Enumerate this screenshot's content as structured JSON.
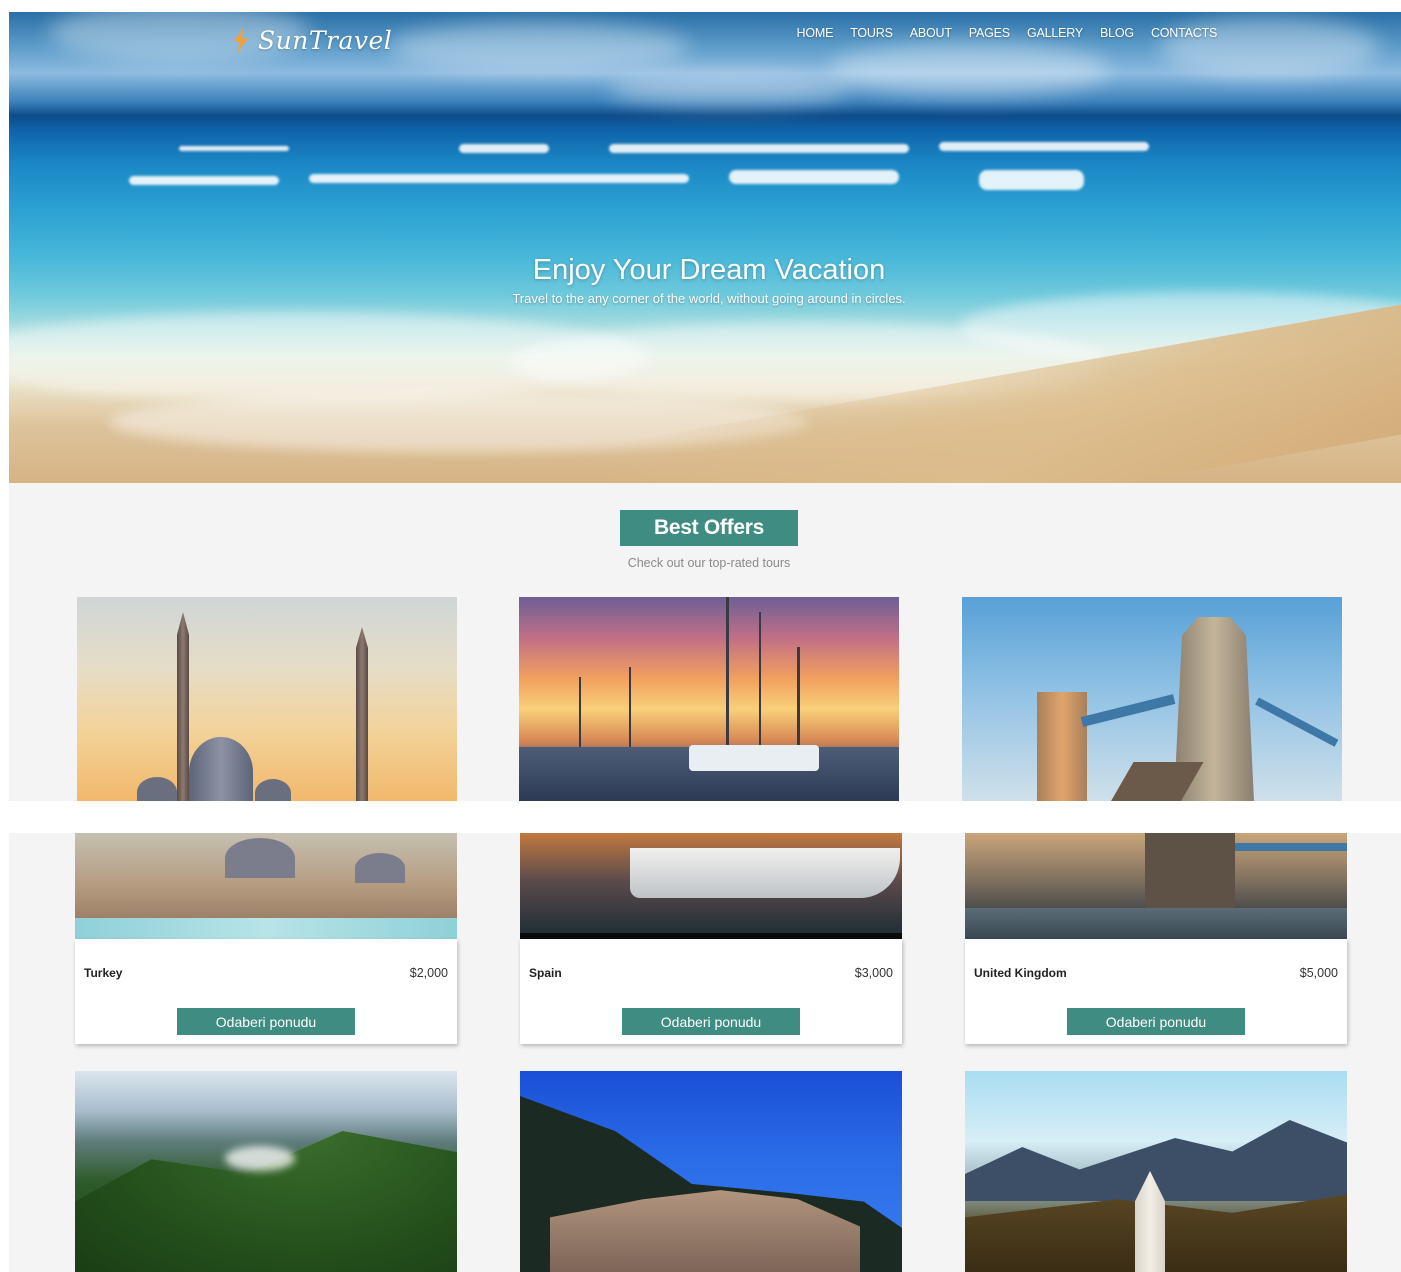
{
  "brand": {
    "name": "SunTravel",
    "accent": "#f2a03d"
  },
  "nav": [
    "HOME",
    "TOURS",
    "ABOUT",
    "PAGES",
    "GALLERY",
    "BLOG",
    "CONTACTS"
  ],
  "hero": {
    "title": "Enjoy Your Dream Vacation",
    "subtitle": "Travel to the any corner of the world, without going around in circles."
  },
  "offers": {
    "title": "Best Offers",
    "subtitle": "Check out our top-rated tours",
    "accent": "#3f8c82",
    "cards": [
      {
        "name": "Turkey",
        "price": "$2,000",
        "button": "Odaberi ponudu",
        "image": "istanbul-mosque-photo"
      },
      {
        "name": "Spain",
        "price": "$3,000",
        "button": "Odaberi ponudu",
        "image": "marina-sunset-photo"
      },
      {
        "name": "United Kingdom",
        "price": "$5,000",
        "button": "Odaberi ponudu",
        "image": "tower-bridge-photo"
      }
    ],
    "more_cards": [
      {
        "image": "green-mountains-photo"
      },
      {
        "image": "coastal-town-night-photo"
      },
      {
        "image": "alpine-church-photo"
      }
    ]
  }
}
